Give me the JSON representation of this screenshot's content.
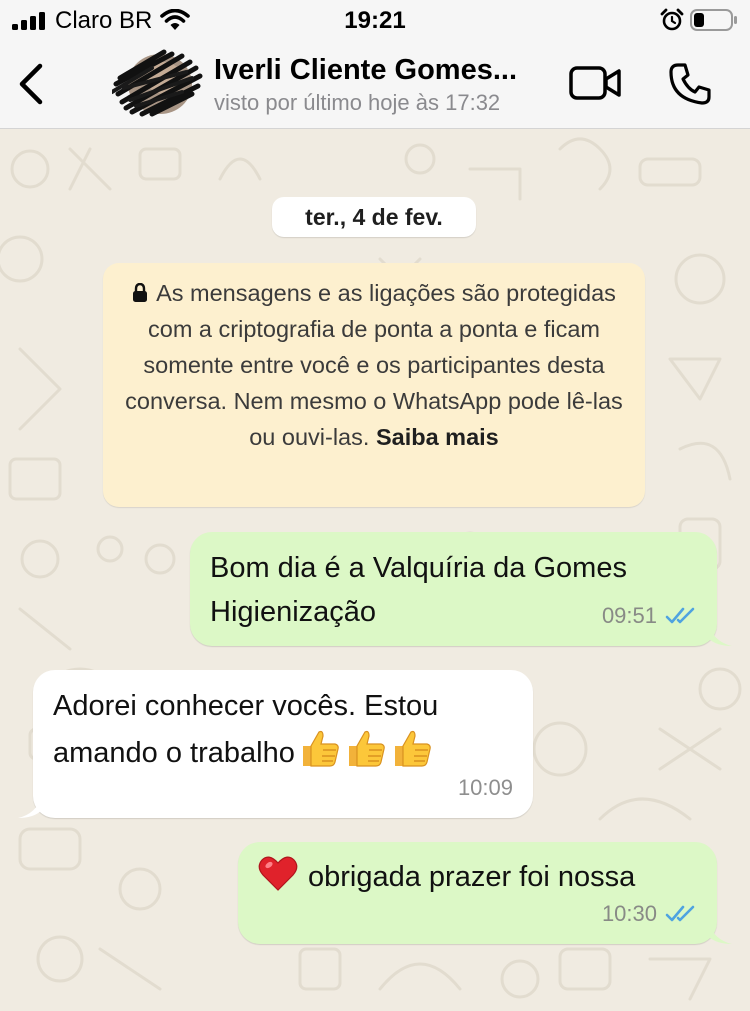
{
  "status_bar": {
    "carrier": "Claro BR",
    "time": "19:21",
    "icons": [
      "signal-icon",
      "wifi-icon",
      "alarm-icon",
      "battery-icon"
    ]
  },
  "header": {
    "contact_name": "Iverli Cliente Gomes...",
    "last_seen": "visto por último hoje às 17:32",
    "icons": [
      "back-chevron-icon",
      "video-call-icon",
      "phone-icon"
    ]
  },
  "chat": {
    "date_label": "ter., 4 de fev.",
    "encryption_notice": {
      "text": "As mensagens e as ligações são protegidas com a criptografia de ponta a ponta e ficam somente entre você e os participantes desta conversa. Nem mesmo o WhatsApp pode lê-las ou ouvi-las.",
      "link": "Saiba mais"
    },
    "messages": [
      {
        "direction": "outgoing",
        "text": "Bom dia é a Valquíria da Gomes Higienização",
        "time": "09:51",
        "status": "read"
      },
      {
        "direction": "incoming",
        "text": "Adorei conhecer vocês. Estou amando o trabalho",
        "emoji": "👍👍👍",
        "time": "10:09"
      },
      {
        "direction": "outgoing",
        "emoji": "❤️",
        "text": "obrigada prazer foi nossa",
        "time": "10:30",
        "status": "read"
      }
    ]
  },
  "colors": {
    "outgoing_bubble": "#dcf8c6",
    "incoming_bubble": "#ffffff",
    "notice_bg": "#fdf0cf",
    "read_ticks": "#4fa3e0",
    "chat_bg": "#f0ebe1"
  }
}
